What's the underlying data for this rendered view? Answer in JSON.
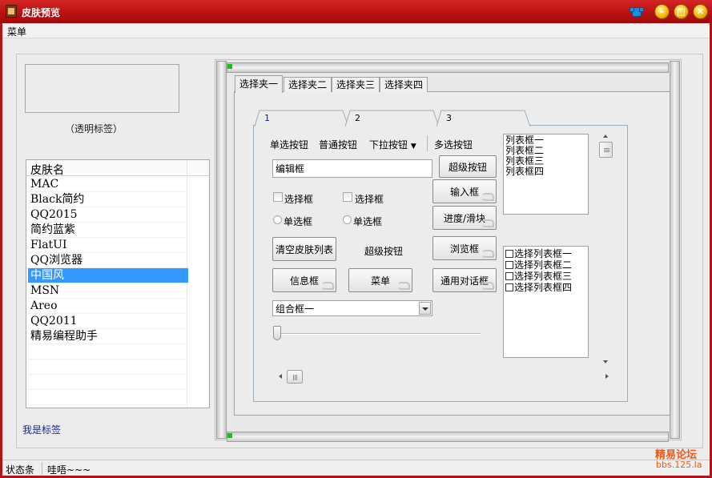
{
  "window": {
    "title": "皮肤预览"
  },
  "menubar": {
    "menu_label": "菜单"
  },
  "left": {
    "transparent_label": "（透明标签）",
    "skin_list": {
      "header": "皮肤名",
      "items": [
        "MAC",
        "Black简约",
        "QQ2015",
        "简约蓝紫",
        "FlatUI",
        "QQ浏览器",
        "中国风",
        "MSN",
        "Areo",
        "QQ2011",
        "精易编程助手"
      ],
      "selected": "中国风"
    },
    "bottom_label": "我是标签"
  },
  "outer_tabs": [
    "选择夹一",
    "选择夹二",
    "选择夹三",
    "选择夹四"
  ],
  "inner_tabs": [
    "1",
    "2",
    "3"
  ],
  "controls": {
    "radio_button_label": "单选按钮",
    "normal_button_label": "普通按钮",
    "dropdown_button_label": "下拉按钮",
    "multi_select_button_label": "多选按钮",
    "edit_box_value": "编辑框",
    "super_button_label": "超级按钮",
    "input_box_button": "输入框",
    "progress_slider_button": "进度/滑块",
    "checkbox_1_label": "选择框",
    "checkbox_2_label": "选择框",
    "radio_1_label": "单选框",
    "radio_2_label": "单选框",
    "clear_skin_list_button": "清空皮肤列表",
    "super_button_text": "超级按钮",
    "browse_box_button": "浏览框",
    "info_box_button": "信息框",
    "menu_button": "菜单",
    "common_dialog_button": "通用对话框",
    "combo_value": "组合框一"
  },
  "list_box": {
    "items": [
      "列表框一",
      "列表框二",
      "列表框三",
      "列表框四"
    ]
  },
  "check_list_box": {
    "items": [
      "选择列表框一",
      "选择列表框二",
      "选择列表框三",
      "选择列表框四"
    ]
  },
  "statusbar": {
    "left": "状态条",
    "right": "哇唔~~~"
  },
  "watermark": {
    "title": "精易论坛",
    "url": "bbs.125.la"
  }
}
